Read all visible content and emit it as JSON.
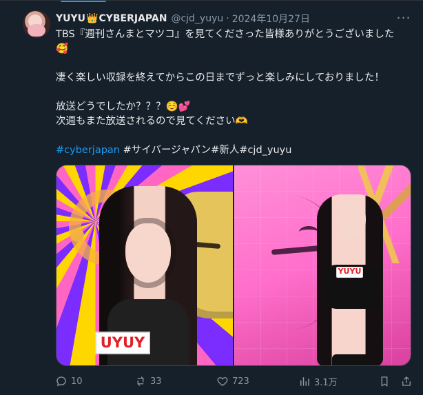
{
  "tweet": {
    "display_name_prefix": "YUYU",
    "display_name_crown": "👑",
    "display_name_suffix": "CYBERJAPAN",
    "handle": "@cjd_yuyu",
    "separator": "·",
    "date": "2024年10月27日",
    "more_icon": "...",
    "text_lines": [
      "TBS『週刊さんまとマツコ』を見てくださった皆様ありがとうございました",
      "🥰",
      "",
      "凄く楽しい収録を終えてからこの日までずっと楽しみにしておりました！",
      "",
      "放送どうでしたか？？？☺️💕",
      "次週もまた放送されるので見てください🫶"
    ],
    "hashtags_line": {
      "blue_tag": "#cyberjapan",
      "white_tags": " #サイバージャパン#新人#cjd_yuyu"
    },
    "media": {
      "left_badge": "UYUY",
      "right_badge": "YUYU"
    },
    "actions": {
      "reply_count": "10",
      "repost_count": "33",
      "like_count": "723",
      "view_count": "3.1万"
    }
  },
  "colors": {
    "background": "#15202b",
    "text": "#e7e9ea",
    "muted": "#8b98a5",
    "link": "#1d9bf0",
    "border": "#38444d"
  },
  "icons": {
    "avatar": "profile-photo",
    "reply": "reply-icon",
    "repost": "repost-icon",
    "like": "heart-icon",
    "views": "views-icon",
    "bookmark": "bookmark-icon",
    "share": "share-icon"
  }
}
